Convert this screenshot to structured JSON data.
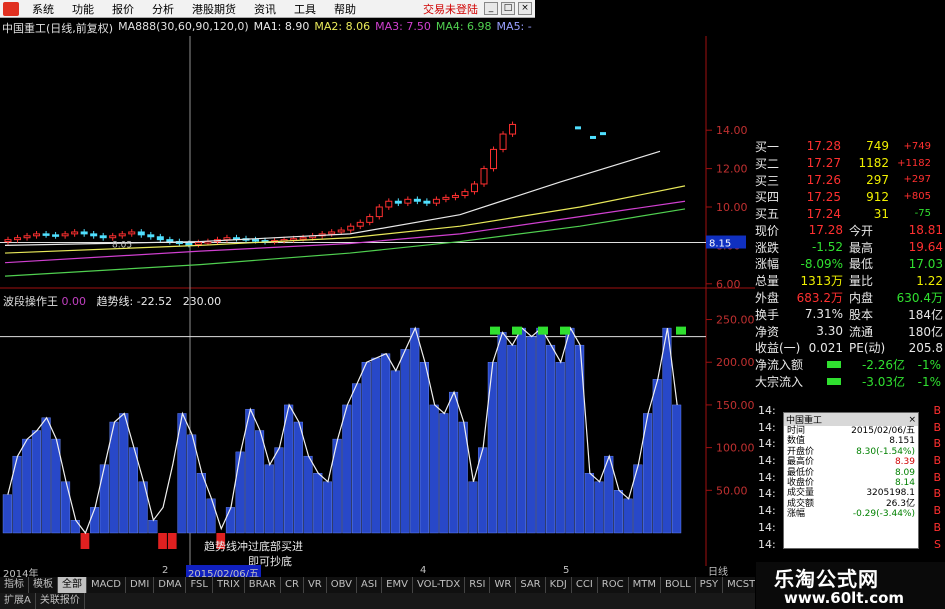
{
  "menubar": {
    "items": [
      "系统",
      "功能",
      "报价",
      "分析",
      "港股期货",
      "资讯",
      "工具",
      "帮助"
    ],
    "trade_label": "交易未登陆",
    "buttons": [
      "_",
      "□",
      "×"
    ]
  },
  "chart_header": {
    "title": "中国重工(日线,前复权)",
    "ma_spec": "MA888(30,60,90,120,0)",
    "ma1": "MA1: 8.90",
    "ma2": "MA2: 8.06",
    "ma3": "MA3: 7.50",
    "ma4": "MA4: 6.98",
    "ma5": "MA5: -"
  },
  "price_axis": {
    "labels": [
      "14.00",
      "12.00",
      "10.00",
      "8.00",
      "6.00"
    ],
    "current": "8.15",
    "low_mark": "8.05"
  },
  "indicator_header": {
    "name": "波段操作王",
    "value": "0.00",
    "trend_label": "趋势线:",
    "trend_value": "-22.52",
    "level": "230.00"
  },
  "indicator_axis": {
    "labels": [
      "250.00",
      "200.00",
      "150.00",
      "100.00",
      "50.00"
    ]
  },
  "annotations": {
    "line1": "趋势线冲过底部买进",
    "line2": "即可抄底"
  },
  "chart_data": [
    {
      "type": "line",
      "name": "price-candles",
      "y_ticks": [
        6,
        8,
        10,
        12,
        14
      ],
      "ylim": [
        5,
        15
      ],
      "current_price": 8.15
    },
    {
      "type": "bar",
      "name": "波段操作王",
      "ylim": [
        0,
        260
      ],
      "level": 230,
      "y_ticks": [
        50,
        100,
        150,
        200,
        250
      ]
    }
  ],
  "order_book": [
    {
      "label": "买一",
      "price": "17.28",
      "vol": "749",
      "chg": "+749",
      "vol_color": "yel"
    },
    {
      "label": "买二",
      "price": "17.27",
      "vol": "1182",
      "chg": "+1182",
      "vol_color": "yel"
    },
    {
      "label": "买三",
      "price": "17.26",
      "vol": "297",
      "chg": "+297",
      "vol_color": "yel"
    },
    {
      "label": "买四",
      "price": "17.25",
      "vol": "912",
      "chg": "+805",
      "vol_color": "yel"
    },
    {
      "label": "买五",
      "price": "17.24",
      "vol": "31",
      "chg": "-75",
      "vol_color": "yel"
    }
  ],
  "quote_fields": [
    {
      "k1": "现价",
      "v1": "17.28",
      "c1": "red",
      "k2": "今开",
      "v2": "18.81",
      "c2": "red"
    },
    {
      "k1": "涨跌",
      "v1": "-1.52",
      "c1": "grn",
      "k2": "最高",
      "v2": "19.64",
      "c2": "red"
    },
    {
      "k1": "涨幅",
      "v1": "-8.09%",
      "c1": "grn",
      "k2": "最低",
      "v2": "17.03",
      "c2": "grn"
    },
    {
      "k1": "总量",
      "v1": "1313万",
      "c1": "yel",
      "k2": "量比",
      "v2": "1.22",
      "c2": "yel"
    },
    {
      "k1": "外盘",
      "v1": "683.2万",
      "c1": "red",
      "k2": "内盘",
      "v2": "630.4万",
      "c2": "grn"
    },
    {
      "k1": "换手",
      "v1": "7.31%",
      "c1": "wht",
      "k2": "股本",
      "v2": "184亿",
      "c2": "wht"
    },
    {
      "k1": "净资",
      "v1": "3.30",
      "c1": "wht",
      "k2": "流通",
      "v2": "180亿",
      "c2": "wht"
    },
    {
      "k1": "收益(一)",
      "v1": "0.021",
      "c1": "wht",
      "k2": "PE(动)",
      "v2": "205.8",
      "c2": "wht"
    }
  ],
  "flows": [
    {
      "label": "净流入额",
      "value": "-2.26亿",
      "pct": "-1%"
    },
    {
      "label": "大宗流入",
      "value": "-3.03亿",
      "pct": "-1%"
    }
  ],
  "ticks": [
    {
      "t": "14:",
      "v": "17.28",
      "b": "B"
    },
    {
      "t": "14:",
      "v": "",
      "b": "B"
    },
    {
      "t": "14:",
      "v": "",
      "b": "B"
    },
    {
      "t": "14:",
      "v": "",
      "b": "B"
    },
    {
      "t": "14:",
      "v": "",
      "b": "B"
    },
    {
      "t": "14:",
      "v": "",
      "b": "B"
    },
    {
      "t": "14:",
      "v": "",
      "b": "B"
    },
    {
      "t": "14:",
      "v": "",
      "b": "B"
    },
    {
      "t": "14:",
      "v": "",
      "b": "S"
    }
  ],
  "popup": {
    "title": "中国重工",
    "close": "×",
    "rows": [
      {
        "k": "时间",
        "v": "2015/02/06/五",
        "c": ""
      },
      {
        "k": "数值",
        "v": "8.151",
        "c": ""
      },
      {
        "k": "开盘价",
        "v": "8.30(-1.54%)",
        "c": "g"
      },
      {
        "k": "最高价",
        "v": "8.39",
        "c": "r"
      },
      {
        "k": "最低价",
        "v": "8.09",
        "c": "g"
      },
      {
        "k": "收盘价",
        "v": "8.14",
        "c": "g"
      },
      {
        "k": "成交量",
        "v": "3205198.1",
        "c": ""
      },
      {
        "k": "成交额",
        "v": "26.3亿",
        "c": ""
      },
      {
        "k": "涨幅",
        "v": "-0.29(-3.44%)",
        "c": "g"
      }
    ]
  },
  "xaxis": {
    "labels": [
      "2014年",
      "2",
      "2015/02/06/五",
      "4",
      "5"
    ]
  },
  "tabs": [
    "指标",
    "模板",
    "全部",
    "MACD",
    "DMI",
    "DMA",
    "FSL",
    "TRIX",
    "BRAR",
    "CR",
    "VR",
    "OBV",
    "ASI",
    "EMV",
    "VOL-TDX",
    "RSI",
    "WR",
    "SAR",
    "KDJ",
    "CCI",
    "ROC",
    "MTM",
    "BOLL",
    "PSY",
    "MCST"
  ],
  "period_label": "日线",
  "bottom": [
    "扩展A",
    "关联报价"
  ],
  "watermark": {
    "line1": "乐淘公式网",
    "line2": "www.60lt.com"
  }
}
